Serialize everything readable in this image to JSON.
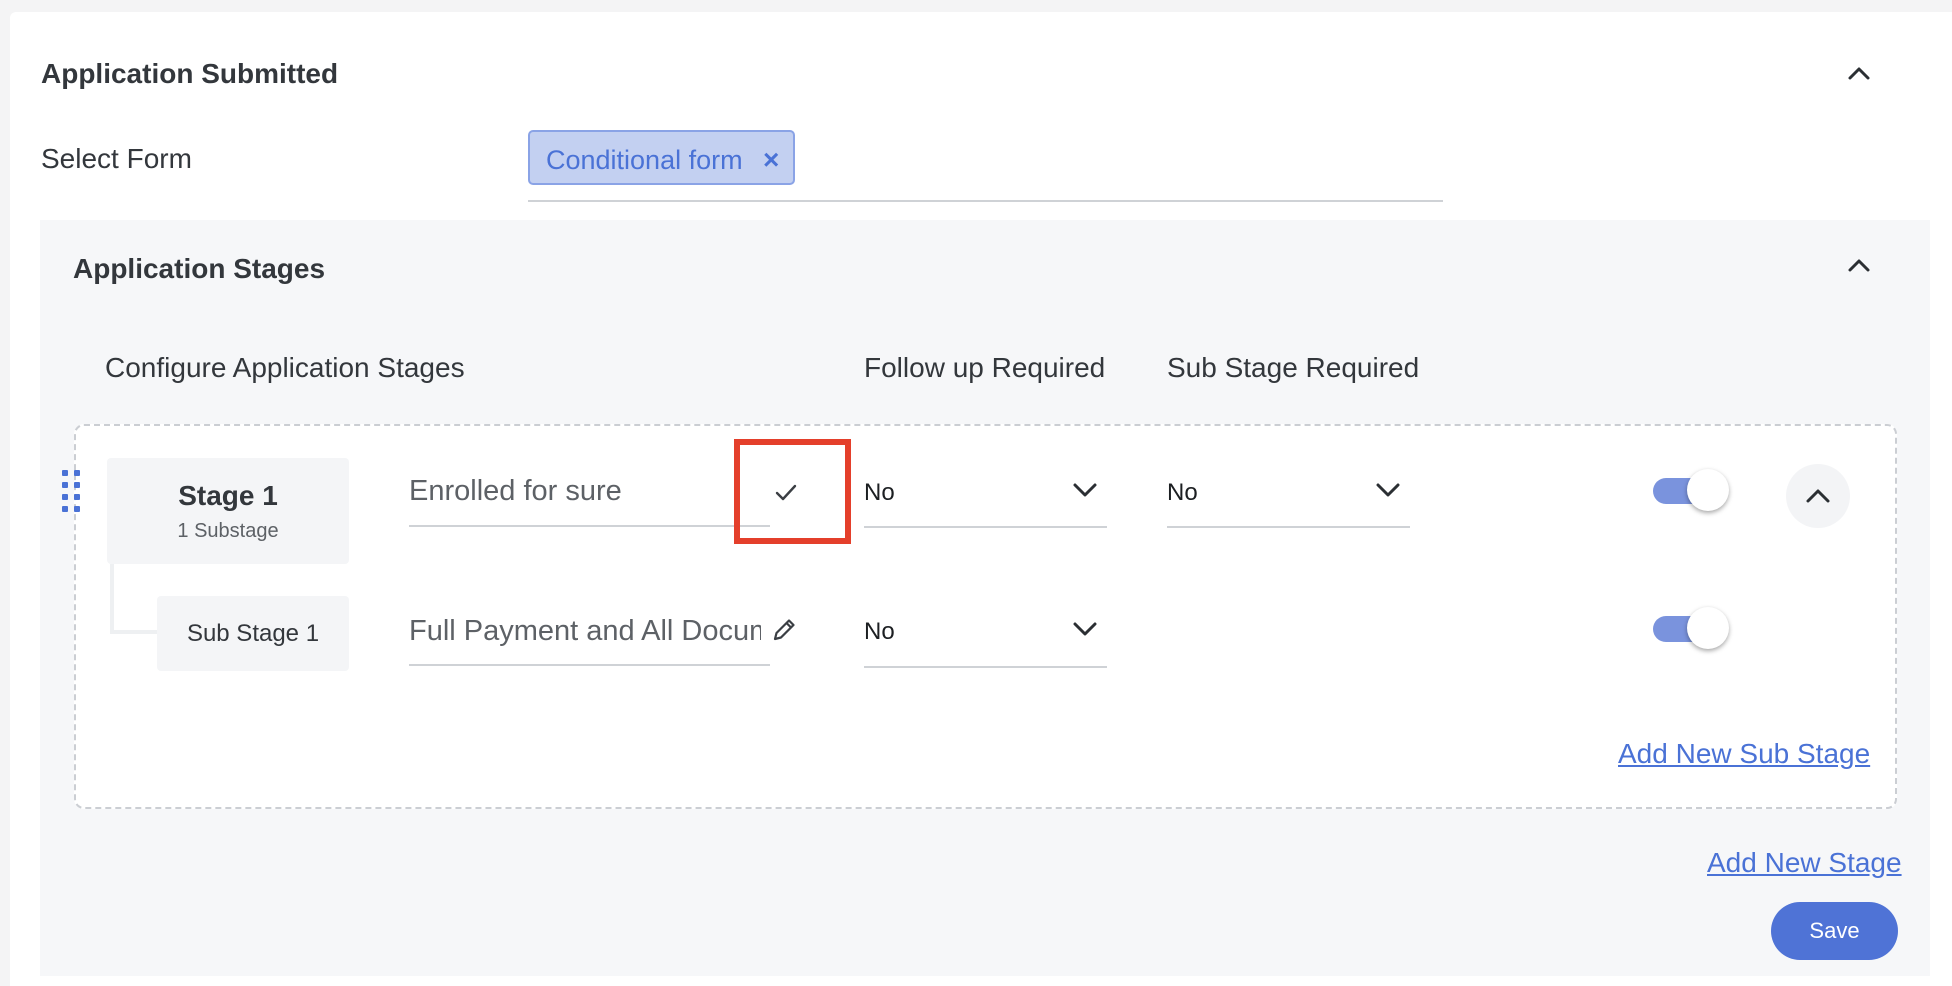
{
  "section": {
    "title": "Application Submitted",
    "select_form_label": "Select Form",
    "selected_form": "Conditional form",
    "chip_remove": "×"
  },
  "stages_panel": {
    "title": "Application Stages",
    "col_configure": "Configure Application Stages",
    "col_follow_up": "Follow up Required",
    "col_sub_stage": "Sub Stage Required"
  },
  "stage": {
    "name": "Stage 1",
    "substage_count": "1 Substage",
    "value": "Enrolled for sure",
    "follow_up": "No",
    "sub_stage_required": "No",
    "enabled": true
  },
  "sub_stage": {
    "name": "Sub Stage 1",
    "value": "Full Payment and All Docum",
    "follow_up": "No",
    "enabled": true
  },
  "links": {
    "add_sub_stage": "Add New Sub Stage",
    "add_stage": "Add New Stage"
  },
  "save_label": "Save",
  "icons": {
    "collapse": "chevron-up-icon",
    "dropdown": "chevron-down-icon",
    "confirm": "check-icon",
    "edit": "pencil-icon",
    "drag": "drag-handle-icon",
    "remove": "close-icon"
  },
  "colors": {
    "accent": "#4a72d6",
    "chip_bg": "#c3d0f1",
    "highlight": "#e43f2b",
    "toggle_track": "#7a93dd"
  }
}
